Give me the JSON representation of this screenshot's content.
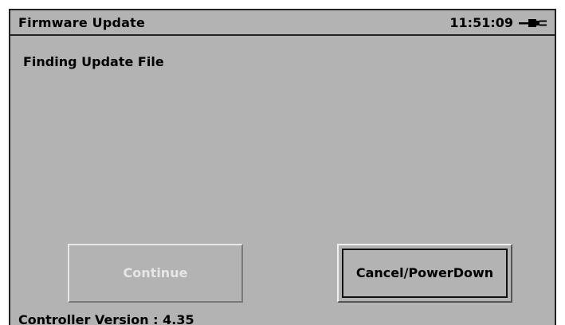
{
  "header": {
    "title": "Firmware Update",
    "clock": "11:51:09",
    "power_icon": "plug-icon"
  },
  "main": {
    "status_message": "Finding Update File"
  },
  "buttons": {
    "continue_label": "Continue",
    "continue_enabled": false,
    "cancel_label": "Cancel/PowerDown"
  },
  "footer": {
    "version_text": "Controller Version : 4.35"
  },
  "colors": {
    "background": "#b3b3b3",
    "text": "#000000",
    "disabled_text": "#e6e6e6"
  }
}
